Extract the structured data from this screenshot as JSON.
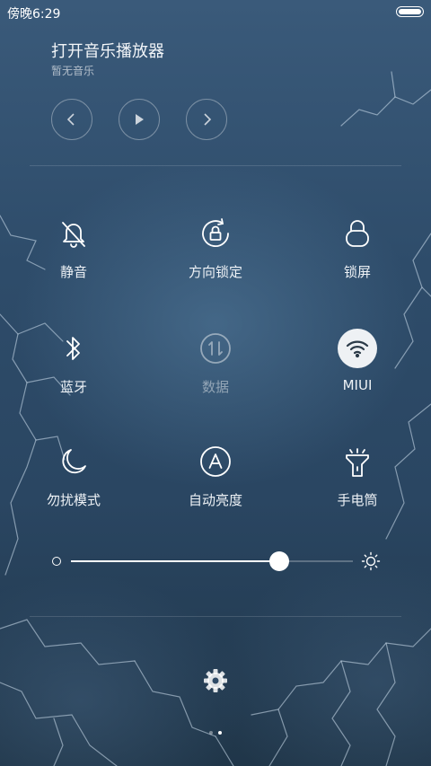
{
  "status_bar": {
    "time": "傍晚6:29"
  },
  "music": {
    "title": "打开音乐播放器",
    "subtitle": "暂无音乐",
    "controls": [
      "previous-icon",
      "play-icon",
      "next-icon"
    ]
  },
  "toggles": [
    {
      "label": "静音",
      "icon": "mute-bell-icon",
      "active": false
    },
    {
      "label": "方向锁定",
      "icon": "rotation-lock-icon",
      "active": false
    },
    {
      "label": "锁屏",
      "icon": "lock-icon",
      "active": false
    },
    {
      "label": "蓝牙",
      "icon": "bluetooth-icon",
      "active": false
    },
    {
      "label": "数据",
      "icon": "mobile-data-icon",
      "active": false,
      "disabled": true
    },
    {
      "label": "MIUI",
      "icon": "wifi-icon",
      "active": true
    },
    {
      "label": "勿扰模式",
      "icon": "moon-icon",
      "active": false
    },
    {
      "label": "自动亮度",
      "icon": "auto-brightness-icon",
      "active": false
    },
    {
      "label": "手电筒",
      "icon": "flashlight-icon",
      "active": false
    }
  ],
  "brightness": {
    "level": 0.74
  },
  "settings_icon": "gear-icon",
  "pager": {
    "pages": 2,
    "current": 2
  },
  "colors": {
    "active_bg": "#eef1f4",
    "text": "#ffffff"
  }
}
